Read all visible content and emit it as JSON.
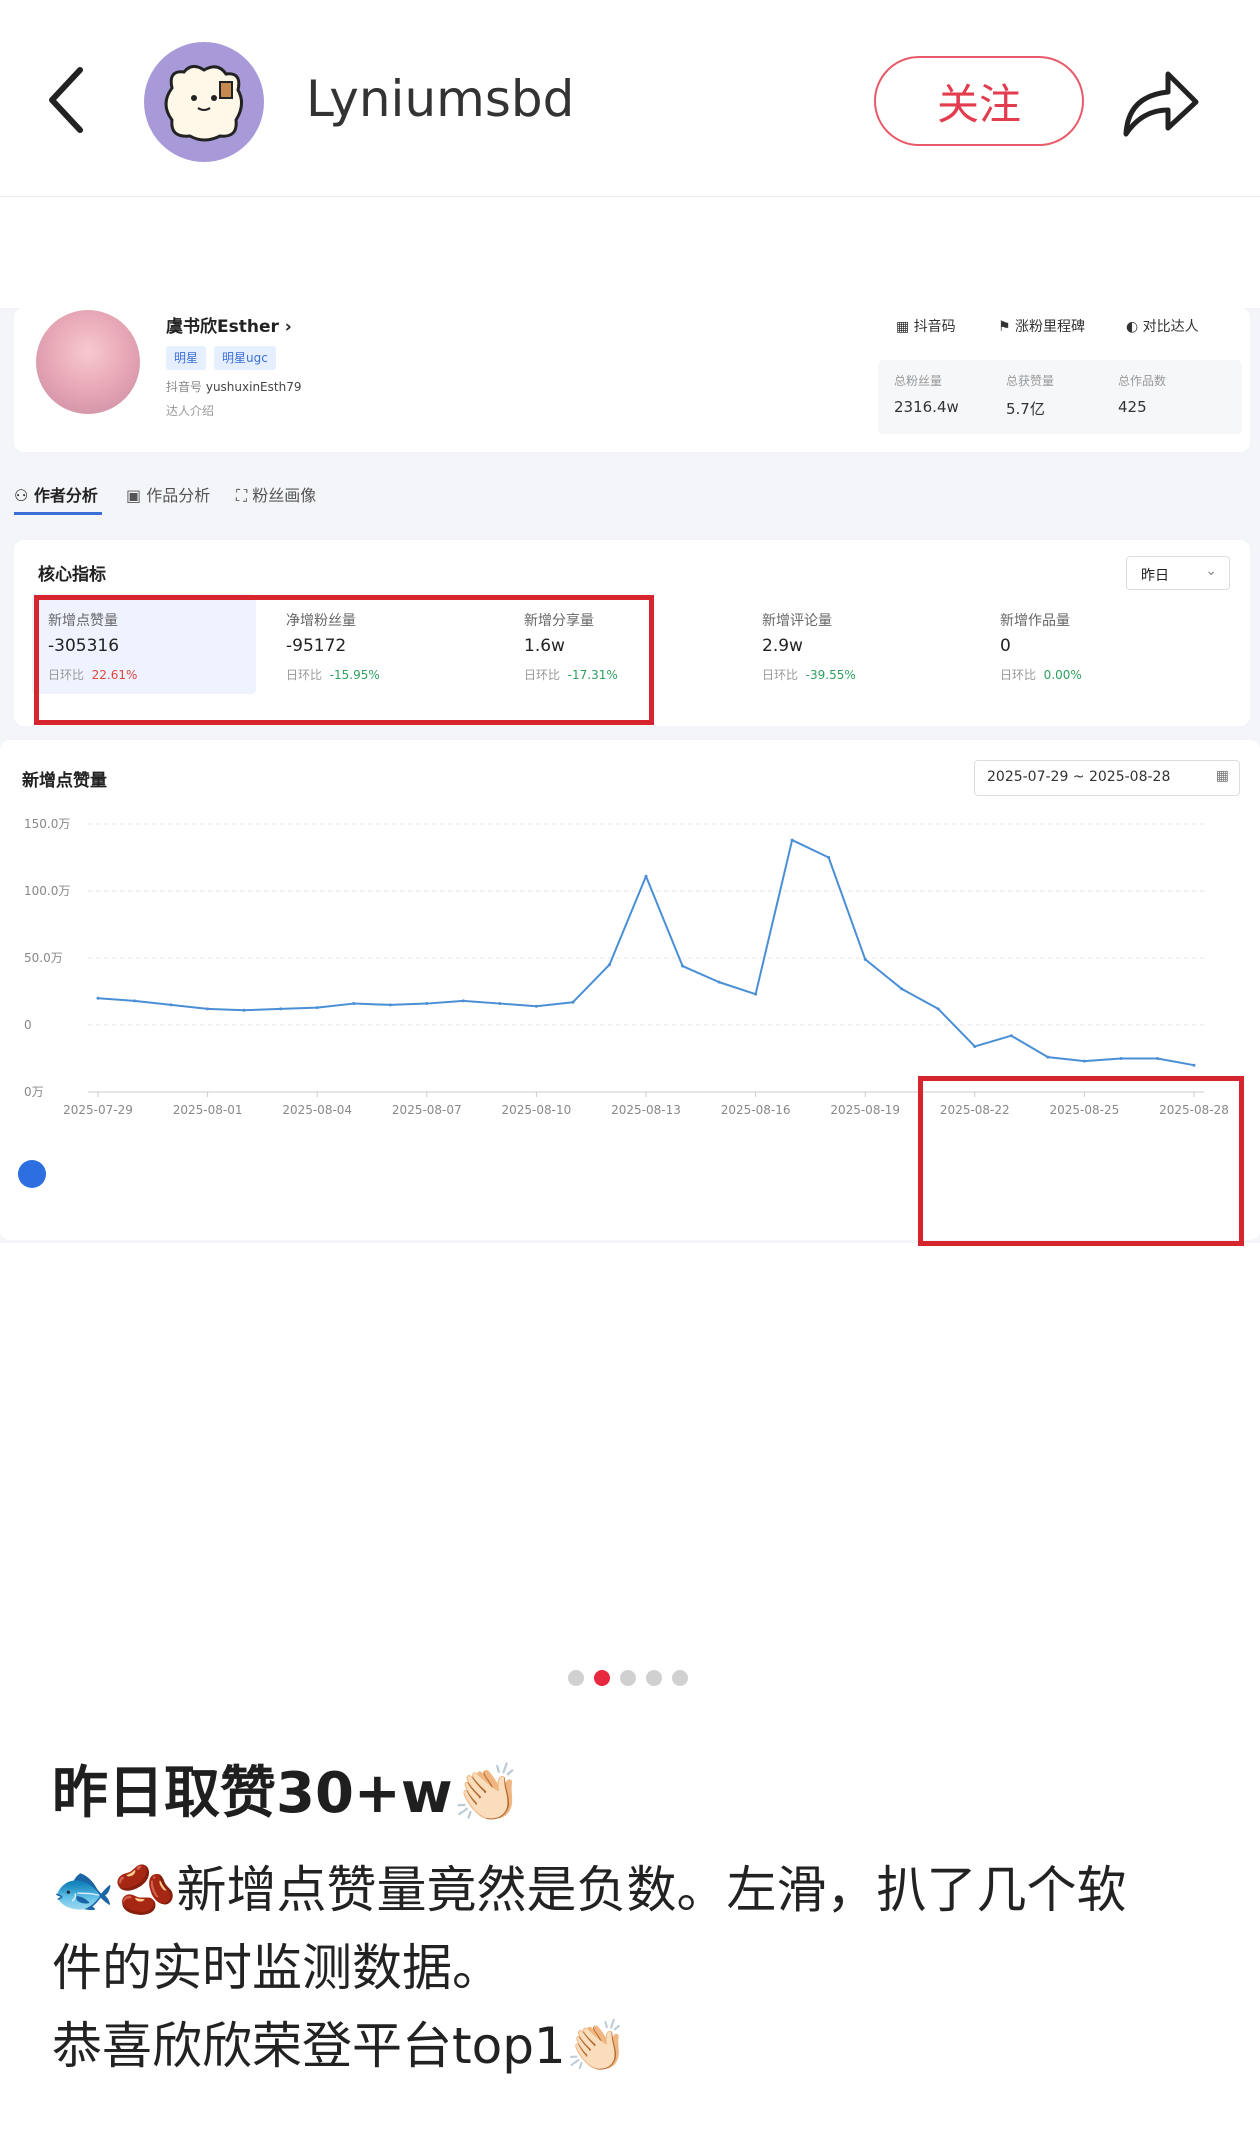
{
  "header": {
    "username": "Lyniumsbd",
    "follow_label": "关注"
  },
  "profile": {
    "name": "虞书欣Esther",
    "tags": [
      "明星",
      "明星ugc"
    ],
    "douyin_id_label": "抖音号",
    "douyin_id": "yushuxinEsth79",
    "intro_label": "达人介绍",
    "actions": [
      "抖音码",
      "涨粉里程碑",
      "对比达人"
    ],
    "stats": [
      {
        "label": "总粉丝量",
        "value": "2316.4w"
      },
      {
        "label": "总获赞量",
        "value": "5.7亿"
      },
      {
        "label": "总作品数",
        "value": "425"
      }
    ]
  },
  "tabs": [
    "作者分析",
    "作品分析",
    "粉丝画像"
  ],
  "metrics": {
    "title": "核心指标",
    "period": "昨日",
    "items": [
      {
        "label": "新增点赞量",
        "value": "-305316",
        "change_label": "日环比",
        "change": "22.61%",
        "dir": "up"
      },
      {
        "label": "净增粉丝量",
        "value": "-95172",
        "change_label": "日环比",
        "change": "-15.95%",
        "dir": "down"
      },
      {
        "label": "新增分享量",
        "value": "1.6w",
        "change_label": "日环比",
        "change": "-17.31%",
        "dir": "down"
      },
      {
        "label": "新增评论量",
        "value": "2.9w",
        "change_label": "日环比",
        "change": "-39.55%",
        "dir": "down"
      },
      {
        "label": "新增作品量",
        "value": "0",
        "change_label": "日环比",
        "change": "0.00%",
        "dir": "down"
      }
    ]
  },
  "chart_data": {
    "type": "line",
    "title": "新增点赞量",
    "date_range": "2025-07-29 ~ 2025-08-28",
    "ylim": [
      -50,
      150
    ],
    "y_ticks": [
      150,
      100,
      50,
      0,
      -50
    ],
    "y_tick_labels": [
      "150.0万",
      "100.0万",
      "50.0万",
      "0",
      "0万"
    ],
    "x_tick_labels": [
      "2025-07-29",
      "2025-08-01",
      "2025-08-04",
      "2025-08-07",
      "2025-08-10",
      "2025-08-13",
      "2025-08-16",
      "2025-08-19",
      "2025-08-22",
      "2025-08-25",
      "2025-08-28"
    ],
    "x": [
      "2025-07-29",
      "2025-07-30",
      "2025-07-31",
      "2025-08-01",
      "2025-08-02",
      "2025-08-03",
      "2025-08-04",
      "2025-08-05",
      "2025-08-06",
      "2025-08-07",
      "2025-08-08",
      "2025-08-09",
      "2025-08-10",
      "2025-08-11",
      "2025-08-12",
      "2025-08-13",
      "2025-08-14",
      "2025-08-15",
      "2025-08-16",
      "2025-08-17",
      "2025-08-18",
      "2025-08-19",
      "2025-08-20",
      "2025-08-21",
      "2025-08-22",
      "2025-08-23",
      "2025-08-24",
      "2025-08-25",
      "2025-08-26",
      "2025-08-27",
      "2025-08-28"
    ],
    "values": [
      20,
      18,
      15,
      12,
      11,
      12,
      13,
      16,
      15,
      16,
      18,
      16,
      14,
      17,
      45,
      111,
      44,
      32,
      23,
      138,
      125,
      49,
      27,
      12,
      -16,
      -8,
      -24,
      -27,
      -25,
      -25,
      -30
    ],
    "grid": true
  },
  "pagination": {
    "count": 5,
    "active": 1
  },
  "post": {
    "title": "昨日取赞30+w👏🏻",
    "lines": [
      "🐟🫘新增点赞量竟然是负数。左滑，扒了几个软",
      "件的实时监测数据。",
      "恭喜欣欣荣登平台top1👏🏻"
    ]
  },
  "colors": {
    "accent": "#3b6fd8",
    "line": "#4a8fd6",
    "highlight_box": "#d7252e",
    "follow": "#e23c4e"
  }
}
